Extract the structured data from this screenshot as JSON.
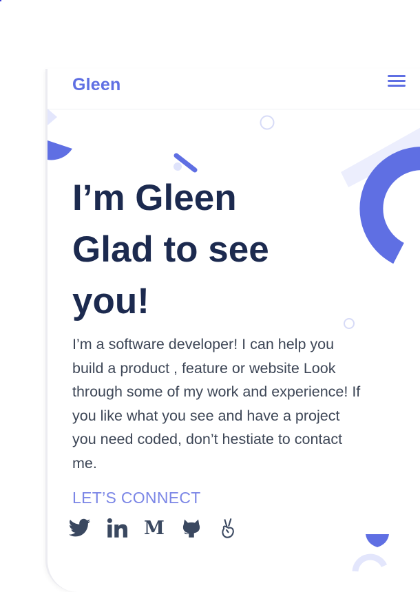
{
  "navbar": {
    "brand": "Gleen",
    "menu_icon": "hamburger-menu-icon"
  },
  "hero": {
    "title_line1": "I’m Gleen",
    "title_line2": "Glad to see",
    "title_line3": "you!",
    "description": "I’m a software developer! I can help you build a product , feature or website Look through some of my work and experience! If you like what you see and have a project you need coded, don’t hestiate to contact me."
  },
  "cta": {
    "connect_label": "LET’S CONNECT"
  },
  "social_icons": [
    "twitter-icon",
    "linkedin-icon",
    "medium-icon",
    "github-icon",
    "angellist-icon"
  ],
  "colors": {
    "accent": "#5f6fe3",
    "accent_light": "#e9ebfd",
    "heading": "#1c2a4f",
    "body_text": "#3d4656",
    "link": "#7b86e6",
    "social": "#3a4860"
  }
}
